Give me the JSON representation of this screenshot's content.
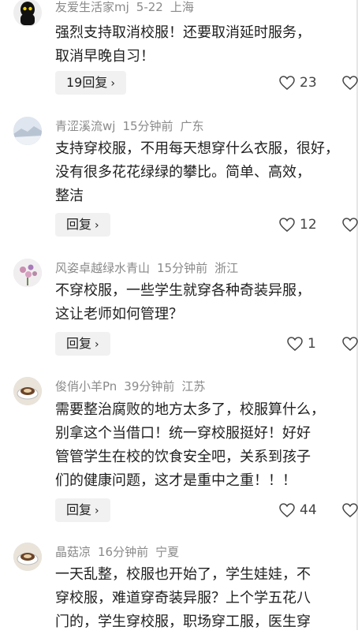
{
  "comments": [
    {
      "username": "友爱生活家mj",
      "time": "5-22",
      "location": "上海",
      "lines": [
        "强烈支持取消校服！还要取消延时服务，",
        "取消早晚自习！"
      ],
      "reply_label": "19回复",
      "likes": "23",
      "avatar": "black-character-avatar"
    },
    {
      "username": "青涩溪流wj",
      "time": "15分钟前",
      "location": "广东",
      "lines": [
        "支持穿校服，不用每天想穿什么衣服，很好，",
        "没有很多花花绿绿的攀比。简单、高效，",
        "整洁"
      ],
      "reply_label": "回复",
      "likes": "12",
      "avatar": "landscape-avatar"
    },
    {
      "username": "风姿卓越绿水青山",
      "time": "15分钟前",
      "location": "浙江",
      "lines": [
        "不穿校服，一些学生就穿各种奇装异服，",
        "这让老师如何管理？"
      ],
      "reply_label": "回复",
      "likes": "1",
      "avatar": "flower-avatar"
    },
    {
      "username": "俊俏小羊Pn",
      "time": "39分钟前",
      "location": "江苏",
      "lines": [
        "需要整治腐败的地方太多了，校服算什么，",
        "别拿这个当借口！统一穿校服挺好！好好",
        "管管学生在校的饮食安全吧，关系到孩子",
        "们的健康问题，这才是重中之重！！！"
      ],
      "reply_label": "回复",
      "likes": "44",
      "avatar": "coffee-avatar"
    },
    {
      "username": "晶菇凉",
      "time": "16分钟前",
      "location": "宁夏",
      "lines": [
        "一天乱整，校服也开始了，学生娃娃，不",
        "穿校服，难道穿奇装异服？上个学五花八",
        "门的，学生穿校服，职场穿工服，医生穿"
      ],
      "reply_label": "",
      "likes": "",
      "avatar": "coffee-avatar"
    }
  ]
}
